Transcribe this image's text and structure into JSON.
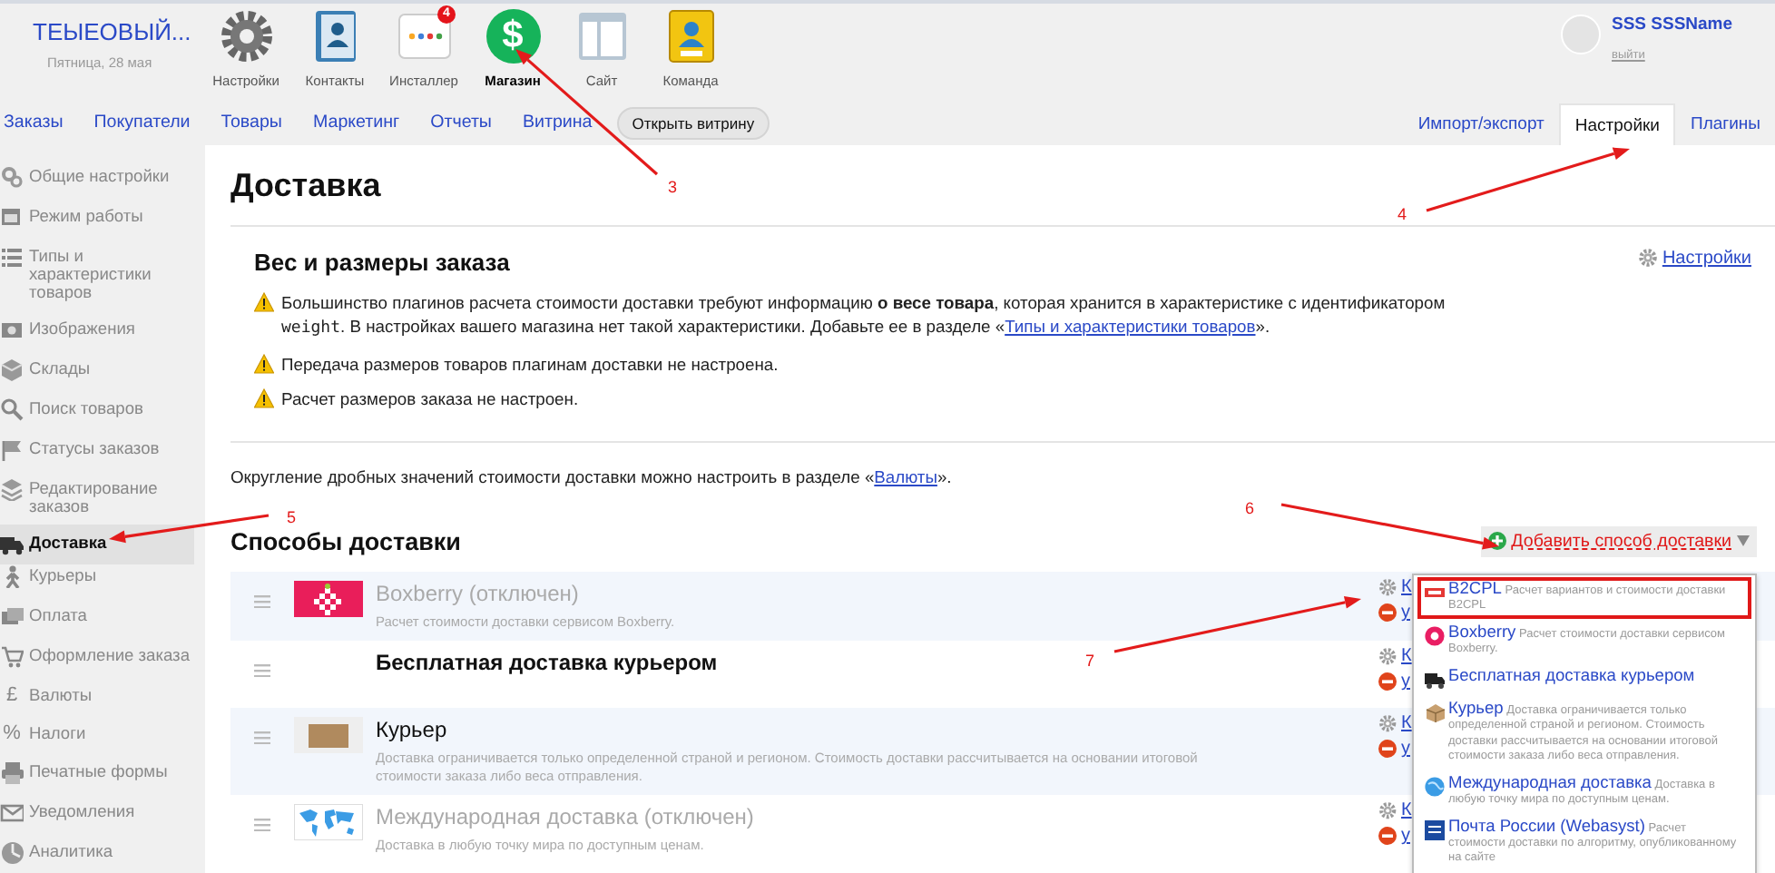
{
  "header": {
    "brand": "ТЕЫЕОВЫЙ...",
    "date": "Пятница, 28 мая",
    "apps": [
      {
        "label": "Настройки",
        "selected": false
      },
      {
        "label": "Контакты",
        "selected": false
      },
      {
        "label": "Инсталлер",
        "selected": false,
        "badge": "4"
      },
      {
        "label": "Магазин",
        "selected": true,
        "icon_text": "$"
      },
      {
        "label": "Сайт",
        "selected": false
      },
      {
        "label": "Команда",
        "selected": false
      }
    ],
    "user": {
      "name": "SSS SSSName",
      "logout": "выйти"
    }
  },
  "nav": {
    "links": [
      "Заказы",
      "Покупатели",
      "Товары",
      "Маркетинг",
      "Отчеты",
      "Витрина"
    ],
    "storefront_button": "Открыть витрину",
    "right_tabs": [
      {
        "label": "Импорт/экспорт",
        "selected": false
      },
      {
        "label": "Настройки",
        "selected": true
      },
      {
        "label": "Плагины",
        "selected": false
      }
    ]
  },
  "sidebar": {
    "items": [
      {
        "label": "Общие настройки",
        "selected": false
      },
      {
        "label": "Режим работы",
        "selected": false
      },
      {
        "label": "Типы и характеристики товаров",
        "selected": false
      },
      {
        "label": "Изображения",
        "selected": false
      },
      {
        "label": "Склады",
        "selected": false
      },
      {
        "label": "Поиск товаров",
        "selected": false
      },
      {
        "label": "Статусы заказов",
        "selected": false
      },
      {
        "label": "Редактирование заказов",
        "selected": false
      },
      {
        "label": "Доставка",
        "selected": true
      },
      {
        "label": "Курьеры",
        "selected": false
      },
      {
        "label": "Оплата",
        "selected": false
      },
      {
        "label": "Оформление заказа",
        "selected": false
      },
      {
        "label": "Валюты",
        "selected": false,
        "glyph": "£"
      },
      {
        "label": "Налоги",
        "selected": false,
        "glyph": "%"
      },
      {
        "label": "Печатные формы",
        "selected": false
      },
      {
        "label": "Уведомления",
        "selected": false
      },
      {
        "label": "Аналитика",
        "selected": false
      }
    ]
  },
  "content": {
    "title": "Доставка",
    "weight_section": {
      "title": "Вес и размеры заказа",
      "settings_link": "Настройки",
      "warnings": [
        {
          "parts": [
            {
              "kind": "text",
              "text": "Большинство плагинов расчета стоимости доставки требуют информацию **о весе товара**, которая хранится в характеристике с идентификатором "
            },
            {
              "kind": "code",
              "text": "weight"
            },
            {
              "kind": "text",
              "text": ". В настройках вашего магазина нет такой характеристики. Добавьте ее в разделе «"
            },
            {
              "kind": "link",
              "text": "Типы и характеристики товаров"
            },
            {
              "kind": "text",
              "text": "»."
            }
          ]
        },
        {
          "parts": [
            {
              "kind": "text",
              "text": "Передача размеров товаров плагинам доставки не настроена."
            }
          ]
        },
        {
          "parts": [
            {
              "kind": "text",
              "text": "Расчет размеров заказа не настроен."
            }
          ]
        }
      ]
    },
    "rounding_note": {
      "parts": [
        {
          "kind": "text",
          "text": "Округление дробных значений стоимости доставки можно настроить в разделе «"
        },
        {
          "kind": "link",
          "text": "Валюты"
        },
        {
          "kind": "text",
          "text": "»."
        }
      ]
    },
    "methods_title": "Способы доставки",
    "add_button": "Добавить способ доставки",
    "methods": [
      {
        "title": "Boxberry (отключен)",
        "description": "Расчет стоимости доставки сервисом Boxberry.",
        "disabled": true,
        "settings_action": "К",
        "delete_action": "у"
      },
      {
        "title": "Бесплатная доставка курьером",
        "disabled": false,
        "settings_action": "К",
        "delete_action": "у"
      },
      {
        "title": "Курьер",
        "description": "Доставка ограничивается только определенной страной и регионом. Стоимость доставки рассчитывается на основании итоговой стоимости заказа либо веса отправления.",
        "disabled": false,
        "settings_action": "К",
        "delete_action": "у"
      },
      {
        "title": "Международная доставка (отключен)",
        "description": "Доставка в любую точку мира по доступным ценам.",
        "disabled": true,
        "settings_action": "К",
        "delete_action": "у"
      }
    ],
    "dropdown": {
      "items": [
        {
          "title": "B2CPL",
          "description": "Расчет вариантов и стоимости доставки B2CPL",
          "highlighted": true
        },
        {
          "title": "Boxberry",
          "description": "Расчет стоимости доставки сервисом Boxberry.",
          "highlighted": false
        },
        {
          "title": "Бесплатная доставка курьером",
          "highlighted": false
        },
        {
          "title": "Курьер",
          "description": "Доставка ограничивается только определенной страной и регионом. Стоимость доставки рассчитывается на основании итоговой стоимости заказа либо веса отправления.",
          "highlighted": false
        },
        {
          "title": "Международная доставка",
          "description": "Доставка в любую точку мира по доступным ценам.",
          "highlighted": false
        },
        {
          "title": "Почта России (Webasyst)",
          "description": "Расчет стоимости доставки по алгоритму, опубликованному на сайте",
          "highlighted": false
        }
      ]
    }
  },
  "annotations": [
    {
      "number": "3"
    },
    {
      "number": "4"
    },
    {
      "number": "5"
    },
    {
      "number": "6"
    },
    {
      "number": "7"
    }
  ]
}
